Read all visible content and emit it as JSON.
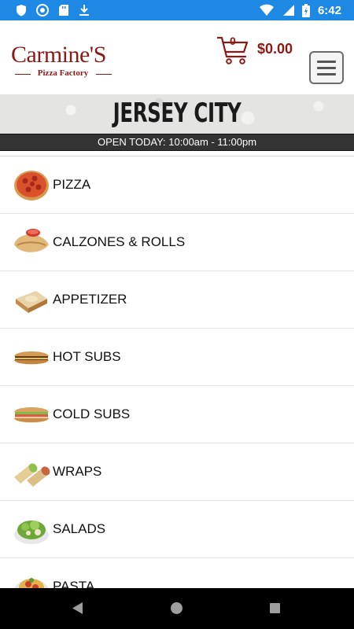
{
  "status_bar": {
    "time": "6:42"
  },
  "header": {
    "logo_main": "Carmine'S",
    "logo_sub": "Pizza Factory",
    "cart_count": "0",
    "cart_total": "$0.00"
  },
  "location": {
    "name": "JERSEY CITY",
    "hours": "OPEN TODAY: 10:00am - 11:00pm"
  },
  "menu": {
    "categories": [
      {
        "label": "PIZZA",
        "icon": "pizza-icon"
      },
      {
        "label": "CALZONES & ROLLS",
        "icon": "calzone-icon"
      },
      {
        "label": "APPETIZER",
        "icon": "appetizer-icon"
      },
      {
        "label": "HOT SUBS",
        "icon": "hot-sub-icon"
      },
      {
        "label": "COLD SUBS",
        "icon": "cold-sub-icon"
      },
      {
        "label": "WRAPS",
        "icon": "wrap-icon"
      },
      {
        "label": "SALADS",
        "icon": "salad-icon"
      },
      {
        "label": "PASTA",
        "icon": "pasta-icon"
      }
    ]
  },
  "colors": {
    "brand": "#8b1a14",
    "status_bar": "#1e88e5",
    "hours_bar": "#333333"
  }
}
